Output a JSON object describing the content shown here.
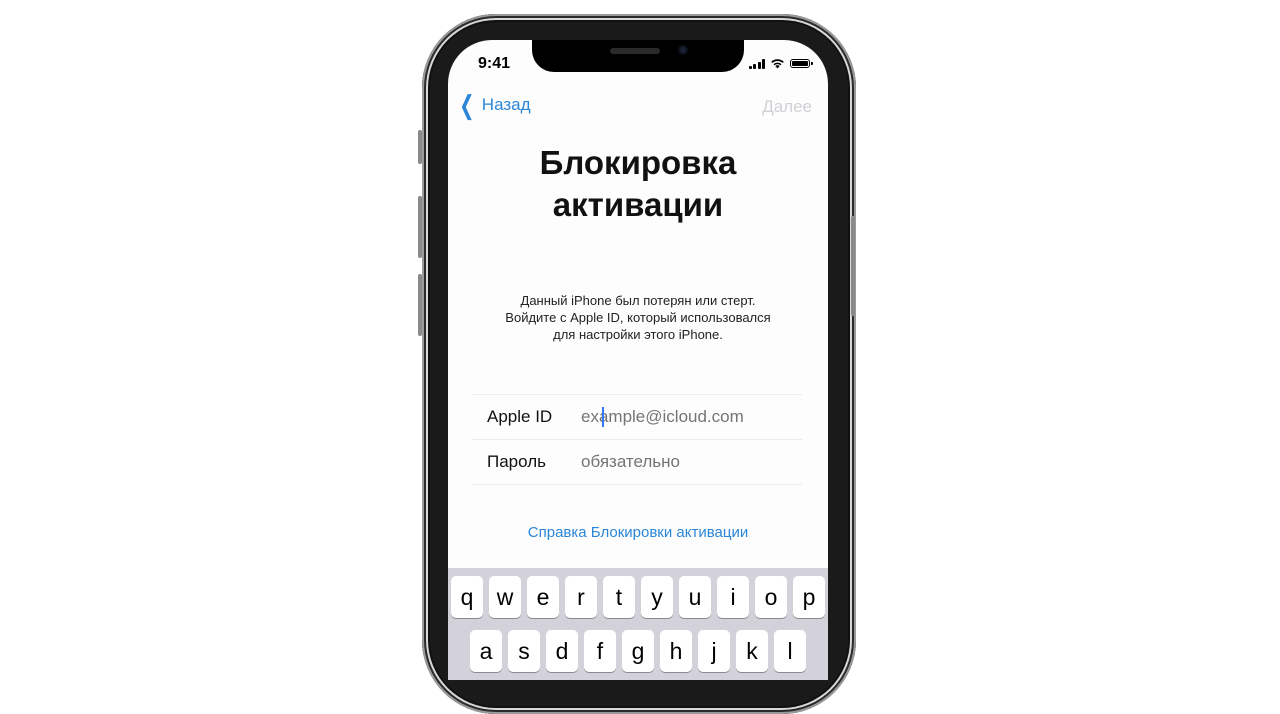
{
  "status_bar": {
    "time": "9:41",
    "icons": [
      "cellular-signal-icon",
      "wifi-icon",
      "battery-icon"
    ]
  },
  "nav": {
    "back_label": "Назад",
    "back_icon": "chevron-left-icon",
    "next_label": "Далее"
  },
  "title": {
    "line1": "Блокировка",
    "line2": "активации"
  },
  "description": {
    "line1": "Данный iPhone был потерян или стерт.",
    "line2": "Войдите с Apple ID, который использовался",
    "line3": "для настройки этого iPhone."
  },
  "form": {
    "apple_id_label": "Apple ID",
    "apple_id_placeholder": "example@icloud.com",
    "apple_id_value": "",
    "password_label": "Пароль",
    "password_placeholder": "обязательно",
    "password_value": ""
  },
  "help_link": "Справка Блокировки активации",
  "keyboard": {
    "row1": [
      "q",
      "w",
      "e",
      "r",
      "t",
      "y",
      "u",
      "i",
      "o",
      "p"
    ],
    "row2": [
      "a",
      "s",
      "d",
      "f",
      "g",
      "h",
      "j",
      "k",
      "l"
    ]
  },
  "colors": {
    "accent": "#2b86d9",
    "disabled": "#d0d0d5",
    "placeholder": "#c4c4c8",
    "caret": "#3478f6",
    "keyboard_bg": "#d3d2da"
  }
}
